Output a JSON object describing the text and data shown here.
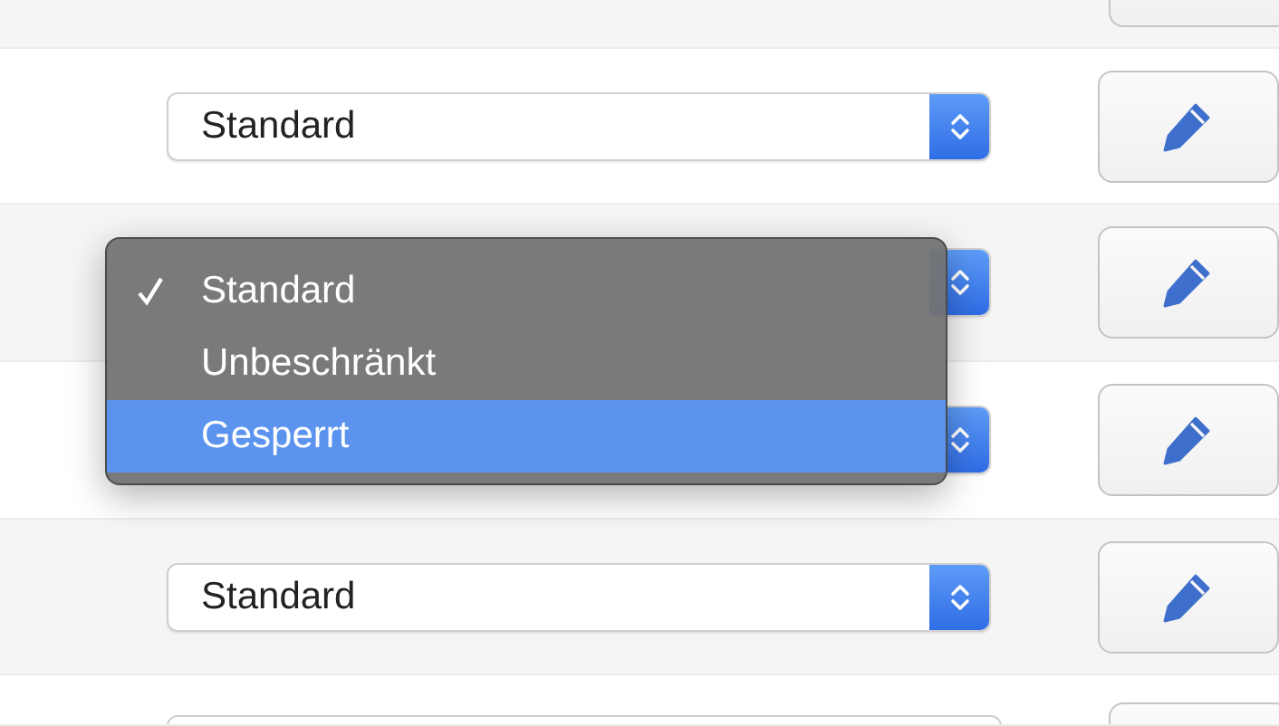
{
  "rows": [
    {
      "kind": "top-edge"
    },
    {
      "kind": "select",
      "value": "Standard"
    },
    {
      "kind": "covered"
    },
    {
      "kind": "covered"
    },
    {
      "kind": "select",
      "value": "Standard"
    },
    {
      "kind": "bottom-edge"
    }
  ],
  "dropdown_menu": {
    "items": [
      {
        "label": "Standard",
        "checked": true,
        "highlighted": false
      },
      {
        "label": "Unbeschränkt",
        "checked": false,
        "highlighted": false
      },
      {
        "label": "Gesperrt",
        "checked": false,
        "highlighted": true
      }
    ]
  }
}
